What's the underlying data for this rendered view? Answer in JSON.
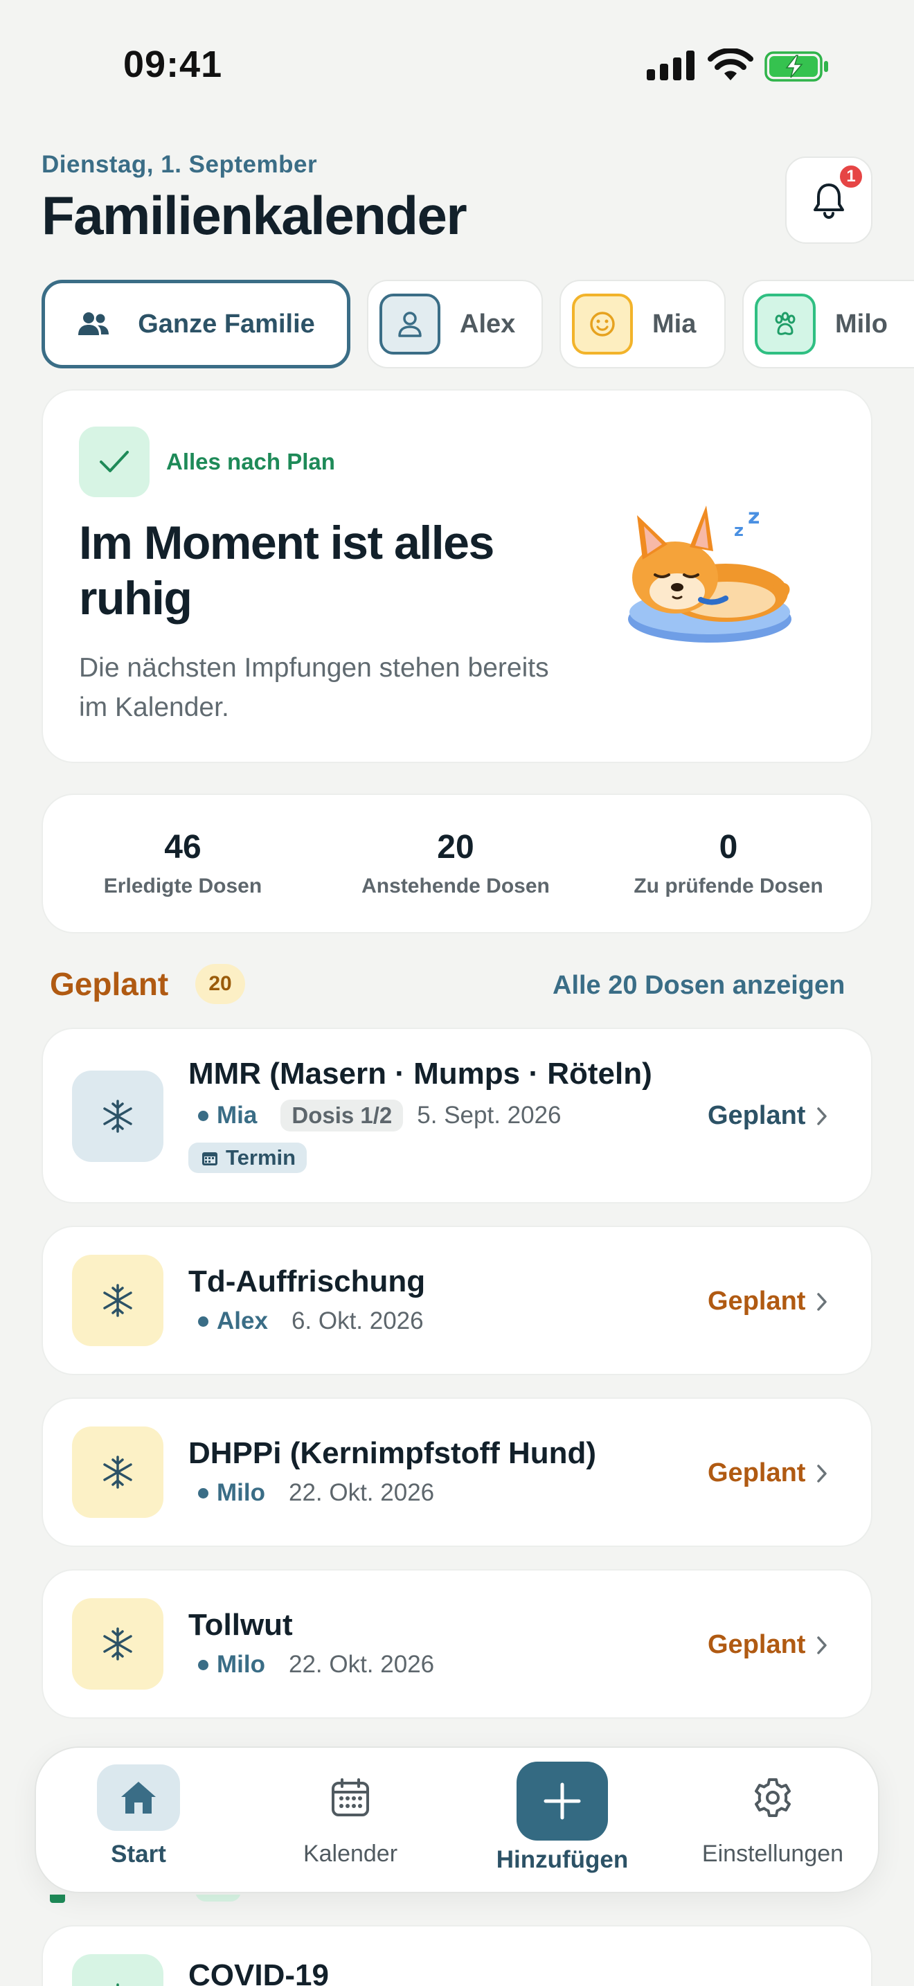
{
  "status_bar": {
    "time": "09:41"
  },
  "header": {
    "date": "Dienstag, 1. September",
    "title": "Familienkalender",
    "notification_count": "1"
  },
  "filters": [
    {
      "label": "Ganze Familie",
      "icon": "family-icon",
      "active": true
    },
    {
      "label": "Alex",
      "icon": "person-icon",
      "color": "#3a6d86"
    },
    {
      "label": "Mia",
      "icon": "smiley-icon",
      "color": "#f2b32a"
    },
    {
      "label": "Milo",
      "icon": "paw-icon",
      "color": "#2fbf82"
    }
  ],
  "status_card": {
    "tag": "Alles nach Plan",
    "headline": "Im Moment ist alles ruhig",
    "subtitle": "Die nächsten Impfungen stehen bereits im Kalender."
  },
  "stats": [
    {
      "value": "46",
      "label": "Erledigte Dosen"
    },
    {
      "value": "20",
      "label": "Anstehende Dosen"
    },
    {
      "value": "0",
      "label": "Zu prüfende Dosen"
    }
  ],
  "section": {
    "title": "Geplant",
    "count": "20",
    "link": "Alle 20 Dosen anzeigen"
  },
  "items": [
    {
      "name": "MMR (Masern · Mumps · Röteln)",
      "who": "Mia",
      "dose": "Dosis 1/2",
      "date": "5. Sept. 2026",
      "tag": "Termin",
      "status": "Geplant",
      "status_color": "#2c5266",
      "icon_bg": "#dde9ef"
    },
    {
      "name": "Td-Auffrischung",
      "who": "Alex",
      "date": "6. Okt. 2026",
      "status": "Geplant",
      "status_color": "#b05a12",
      "icon_bg": "#fcf1c6"
    },
    {
      "name": "DHPPi (Kernimpfstoff Hund)",
      "who": "Milo",
      "date": "22. Okt. 2026",
      "status": "Geplant",
      "status_color": "#b05a12",
      "icon_bg": "#fcf1c6"
    },
    {
      "name": "Tollwut",
      "who": "Milo",
      "date": "22. Okt. 2026",
      "status": "Geplant",
      "status_color": "#b05a12",
      "icon_bg": "#fcf1c6"
    },
    {
      "name": "COVID-19",
      "icon_bg": "#d7f4e4"
    }
  ],
  "nav": [
    {
      "label": "Start",
      "icon": "home-icon",
      "active": true
    },
    {
      "label": "Kalender",
      "icon": "calendar-icon"
    },
    {
      "label": "Hinzufügen",
      "icon": "plus-icon"
    },
    {
      "label": "Einstellungen",
      "icon": "gear-icon"
    }
  ]
}
